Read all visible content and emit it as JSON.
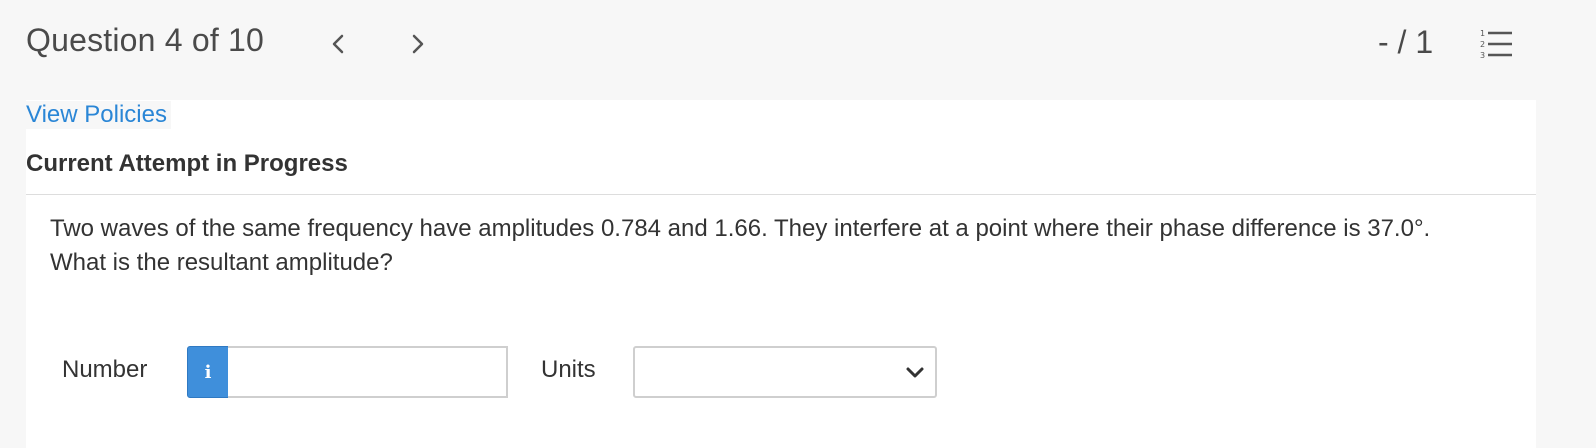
{
  "header": {
    "question_counter": "Question 4 of 10",
    "score": "- / 1",
    "prev_icon": "chevron-left-icon",
    "next_icon": "chevron-right-icon",
    "list_icon": "numbered-list-icon"
  },
  "main": {
    "policies_link": "View Policies",
    "attempt_heading": "Current Attempt in Progress",
    "question_line1": "Two waves of the same frequency have amplitudes 0.784 and 1.66. They interfere at a point where their phase difference is 37.0°.",
    "question_line2": "What is the resultant amplitude?"
  },
  "answer": {
    "number_label": "Number",
    "info_symbol": "i",
    "number_value": "",
    "units_label": "Units",
    "units_selected": ""
  },
  "colors": {
    "accent": "#3f8fdb",
    "link": "#2a86d6",
    "page_bg": "#f7f7f7",
    "panel_bg": "#ffffff"
  }
}
